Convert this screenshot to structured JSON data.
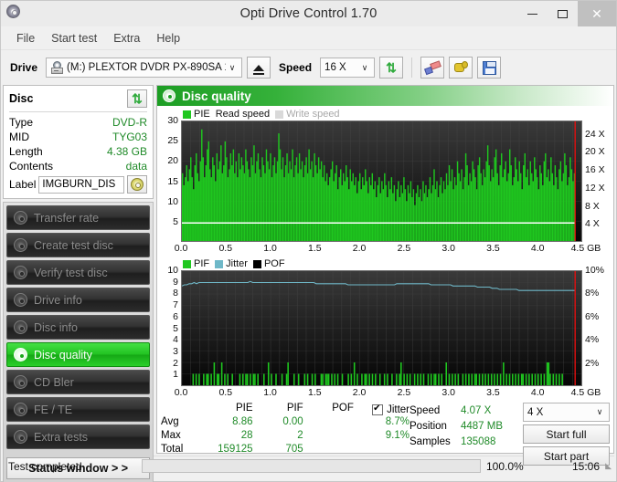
{
  "window": {
    "title": "Opti Drive Control 1.70",
    "app_icon": "disc-icon",
    "minimize": "–",
    "maximize": "□",
    "close": "✕"
  },
  "menu": [
    "File",
    "Start test",
    "Extra",
    "Help"
  ],
  "toolbar": {
    "drive_label": "Drive",
    "drive_value": "(M:)  PLEXTOR DVDR   PX-890SA 1.00",
    "eject_icon": "eject-icon",
    "speed_label": "Speed",
    "speed_value": "16 X",
    "refresh_icon": "refresh-icon",
    "erase_icon": "erase-icon",
    "hand_icon": "hand-icon",
    "save_icon": "save-icon"
  },
  "disc_panel": {
    "title": "Disc",
    "refresh_icon": "refresh-icon",
    "rows": [
      {
        "key": "Type",
        "value": "DVD-R"
      },
      {
        "key": "MID",
        "value": "TYG03"
      },
      {
        "key": "Length",
        "value": "4.38 GB"
      },
      {
        "key": "Contents",
        "value": "data"
      }
    ],
    "label_key": "Label",
    "label_value": "IMGBURN_DIS",
    "label_button_icon": "disc-icon"
  },
  "nav": {
    "items": [
      {
        "label": "Transfer rate",
        "active": false
      },
      {
        "label": "Create test disc",
        "active": false
      },
      {
        "label": "Verify test disc",
        "active": false
      },
      {
        "label": "Drive info",
        "active": false
      },
      {
        "label": "Disc info",
        "active": false
      },
      {
        "label": "Disc quality",
        "active": true
      },
      {
        "label": "CD Bler",
        "active": false
      },
      {
        "label": "FE / TE",
        "active": false
      },
      {
        "label": "Extra tests",
        "active": false
      }
    ],
    "status_window": "Status window > >"
  },
  "content": {
    "header_title": "Disc quality",
    "header_icon": "disc-icon"
  },
  "chart_data": [
    {
      "type": "bar",
      "title": "PIE / Read speed",
      "legend": [
        {
          "label": "PIE",
          "color": "#1fc71f",
          "active": true
        },
        {
          "label": "Read speed",
          "color": "#ffffff",
          "active": true
        },
        {
          "label": "Write speed",
          "color": "#d9d9d9",
          "active": false
        }
      ],
      "xlabel": "GB",
      "xticks": [
        "0.0",
        "0.5",
        "1.0",
        "1.5",
        "2.0",
        "2.5",
        "3.0",
        "3.5",
        "4.0",
        "4.5"
      ],
      "xlim": [
        0.0,
        4.5
      ],
      "ylabel_left": "PIE",
      "yticks_left": [
        5,
        10,
        15,
        20,
        25,
        30
      ],
      "ylim_left": [
        0,
        30
      ],
      "ylabel_right": "Speed",
      "yticks_right": [
        "4 X",
        "8 X",
        "12 X",
        "16 X",
        "20 X",
        "24 X"
      ],
      "ylim_right": [
        0,
        27
      ],
      "grid": true,
      "read_speed_line": 4.07,
      "end_marker_position": 4.43,
      "series": [
        {
          "name": "PIE",
          "color": "#1fc71f",
          "values": [
            17,
            14,
            16,
            19,
            15,
            18,
            21,
            16,
            13,
            19,
            22,
            17,
            15,
            20,
            28,
            21,
            16,
            19,
            23,
            25,
            18,
            16,
            21,
            19,
            15,
            22,
            18,
            20,
            24,
            17,
            19,
            25,
            21,
            16,
            18,
            22,
            19,
            23,
            17,
            20,
            16,
            22,
            18,
            21,
            19,
            17,
            23,
            20,
            18,
            16,
            21,
            19,
            24,
            17,
            20,
            22,
            18,
            16,
            21,
            19,
            17,
            23,
            20,
            18,
            22,
            16,
            19,
            21,
            17,
            20,
            27,
            23,
            18,
            21,
            16,
            19,
            22,
            17,
            20,
            18,
            23,
            16,
            19,
            21,
            17,
            22,
            18,
            20,
            16,
            19,
            21,
            17,
            23,
            18,
            20,
            16,
            22,
            19,
            17,
            21,
            18,
            20,
            16,
            19,
            15,
            17,
            14,
            16,
            18,
            20,
            15,
            17,
            19,
            13,
            16,
            18,
            14,
            17,
            15,
            19,
            16,
            13,
            18,
            15,
            17,
            14,
            16,
            12,
            15,
            17,
            13,
            16,
            14,
            18,
            15,
            12,
            16,
            14,
            17,
            13,
            15,
            11,
            14,
            16,
            12,
            15,
            13,
            17,
            14,
            11,
            15,
            13,
            16,
            12,
            14,
            10,
            13,
            15,
            11,
            14,
            12,
            16,
            13,
            10,
            14,
            12,
            15,
            11,
            13,
            9,
            12,
            14,
            11,
            13,
            10,
            15,
            12,
            14,
            11,
            13,
            16,
            12,
            14,
            18,
            13,
            15,
            11,
            14,
            16,
            12,
            15,
            13,
            17,
            14,
            19,
            15,
            18,
            13,
            16,
            14,
            20,
            17,
            15,
            18,
            13,
            16,
            22,
            19,
            14,
            17,
            15,
            20,
            18,
            16,
            13,
            19,
            21,
            17,
            14,
            18,
            16,
            20,
            24,
            19,
            15,
            18,
            16,
            21,
            23,
            17,
            14,
            19,
            22,
            16,
            18,
            20,
            15,
            17,
            23,
            19,
            14,
            16,
            21,
            18,
            15,
            20,
            17,
            13,
            19,
            22,
            16,
            18,
            14,
            20,
            17,
            15,
            21,
            18,
            16,
            13,
            19,
            17,
            14,
            20,
            22,
            16,
            18,
            15,
            21,
            17,
            14,
            19,
            16,
            13,
            18,
            20,
            15,
            17,
            22,
            19,
            14,
            16,
            21,
            18,
            15,
            17
          ]
        }
      ]
    },
    {
      "type": "bar",
      "title": "PIF / Jitter / POF",
      "legend": [
        {
          "label": "PIF",
          "color": "#1fc71f",
          "active": true
        },
        {
          "label": "Jitter",
          "color": "#6fb8c8",
          "active": true
        },
        {
          "label": "POF",
          "color": "#000000",
          "active": true
        }
      ],
      "xlabel": "GB",
      "xticks": [
        "0.0",
        "0.5",
        "1.0",
        "1.5",
        "2.0",
        "2.5",
        "3.0",
        "3.5",
        "4.0",
        "4.5"
      ],
      "xlim": [
        0.0,
        4.5
      ],
      "ylabel_left": "PIF",
      "yticks_left": [
        1,
        2,
        3,
        4,
        5,
        6,
        7,
        8,
        9,
        10
      ],
      "ylim_left": [
        0,
        10
      ],
      "ylabel_right": "Jitter",
      "yticks_right": [
        "2%",
        "4%",
        "6%",
        "8%",
        "10%"
      ],
      "ylim_right": [
        0,
        10
      ],
      "grid": true,
      "end_marker_position": 4.43,
      "series": [
        {
          "name": "PIF",
          "color": "#1fc71f",
          "values": [
            0,
            0,
            0,
            0,
            0,
            0,
            0,
            1,
            0,
            1,
            0,
            1,
            0,
            0,
            1,
            0,
            1,
            1,
            0,
            1,
            0,
            2,
            0,
            1,
            1,
            0,
            2,
            0,
            1,
            0,
            1,
            0,
            0,
            1,
            0,
            0,
            0,
            0,
            1,
            0,
            1,
            0,
            1,
            1,
            0,
            1,
            0,
            1,
            1,
            0,
            1,
            0,
            0,
            0,
            1,
            0,
            0,
            2,
            0,
            1,
            0,
            0,
            1,
            0,
            0,
            0,
            1,
            0,
            0,
            1,
            2,
            0,
            0,
            0,
            1,
            0,
            0,
            1,
            0,
            0,
            0,
            1,
            0,
            1,
            0,
            0,
            1,
            0,
            1,
            0,
            0,
            0,
            1,
            1,
            0,
            1,
            1,
            1,
            0,
            1,
            0,
            1,
            0,
            1,
            0,
            0,
            1,
            0,
            0,
            0,
            1,
            0,
            1,
            0,
            2,
            0,
            1,
            0,
            0,
            1,
            0,
            1,
            1,
            0,
            1,
            0,
            1,
            0,
            1,
            0,
            0,
            1,
            0,
            0,
            1,
            0,
            1,
            0,
            0,
            1,
            0,
            0,
            1,
            0,
            1,
            2,
            0,
            1,
            0,
            1,
            0,
            1,
            0,
            0,
            1,
            0,
            1,
            0,
            1,
            0,
            1,
            0,
            0,
            1,
            0,
            1,
            0,
            1,
            1,
            0,
            1,
            0,
            1,
            0,
            0,
            2,
            0,
            1,
            0,
            1,
            0,
            1,
            0,
            1,
            0,
            0,
            1,
            0,
            1,
            0,
            1,
            0,
            1,
            0,
            1,
            1,
            0,
            1,
            0,
            1,
            0,
            1,
            0,
            1,
            0,
            1,
            0,
            1,
            0,
            1,
            0,
            1,
            0,
            2,
            0,
            1,
            0,
            1,
            0,
            1,
            0,
            1,
            0,
            1,
            0,
            1,
            1,
            0,
            1,
            0,
            1,
            0,
            1,
            0,
            1,
            0,
            1,
            0,
            1,
            0,
            1,
            0,
            2,
            2,
            1,
            0,
            1,
            0,
            1,
            0,
            1,
            0,
            1,
            0,
            0,
            0,
            0,
            0,
            0,
            0,
            0
          ]
        },
        {
          "name": "Jitter",
          "color": "#6fb8c8",
          "values": [
            8.7,
            8.8,
            8.8,
            8.9,
            8.9,
            9.0,
            8.9,
            9.0,
            9.0,
            9.0,
            9.0,
            9.0,
            9.0,
            9.0,
            9.0,
            9.0,
            9.0,
            9.0,
            9.0,
            9.0,
            9.0,
            9.0,
            9.0,
            9.0,
            9.0,
            9.0,
            9.0,
            9.0,
            9.1,
            9.0,
            9.0,
            9.0,
            9.0,
            9.0,
            9.0,
            9.0,
            9.0,
            9.0,
            9.0,
            9.0,
            9.0,
            9.0,
            9.0,
            9.0,
            9.0,
            9.0,
            9.0,
            9.0,
            9.0,
            9.0,
            9.0,
            9.0,
            9.0,
            9.0,
            9.0,
            8.9,
            8.9,
            8.9,
            8.9,
            8.9,
            8.9,
            8.9,
            8.9,
            8.9,
            8.9,
            8.9,
            8.9,
            8.9,
            8.8,
            8.8,
            8.8,
            8.8,
            8.8,
            8.8,
            8.8,
            8.8,
            8.8,
            8.8,
            8.8,
            8.8,
            8.8,
            8.8,
            8.8,
            8.8,
            8.8,
            8.8,
            8.8,
            8.8,
            8.9,
            8.9,
            8.9,
            8.9,
            8.9,
            8.9,
            8.9,
            8.9,
            8.9,
            8.9,
            8.9,
            8.9,
            8.9,
            8.9,
            8.8,
            8.8,
            8.8,
            8.8,
            8.8,
            8.8,
            8.8,
            8.8,
            8.8,
            8.7,
            8.7,
            8.7,
            8.7,
            8.7,
            8.7,
            8.7,
            8.7,
            8.7,
            8.7,
            8.6,
            8.6,
            8.6,
            8.6,
            8.6,
            8.6,
            8.5,
            8.5,
            8.5,
            8.4,
            8.4,
            8.4,
            8.4,
            8.4,
            8.4,
            8.4,
            8.4,
            8.3,
            8.3,
            8.3,
            8.3,
            8.3,
            8.3,
            8.3,
            8.3,
            8.3,
            8.3,
            8.3,
            8.3,
            8.3,
            8.3,
            8.3,
            8.3,
            8.3,
            8.3,
            8.3,
            8.3,
            8.3,
            8.3,
            8.3,
            8.3
          ]
        }
      ]
    }
  ],
  "stats": {
    "columns": [
      "PIE",
      "PIF",
      "POF",
      "Jitter"
    ],
    "jitter_checkbox_checked": true,
    "rows": [
      {
        "label": "Avg",
        "pie": "8.86",
        "pif": "0.00",
        "pof": "",
        "jitter": "8.7%"
      },
      {
        "label": "Max",
        "pie": "28",
        "pif": "2",
        "pof": "",
        "jitter": "9.1%"
      },
      {
        "label": "Total",
        "pie": "159125",
        "pif": "705",
        "pof": "",
        "jitter": ""
      }
    ],
    "info": [
      {
        "key": "Speed",
        "value": "4.07 X"
      },
      {
        "key": "Position",
        "value": "4487 MB"
      },
      {
        "key": "Samples",
        "value": "135088"
      }
    ],
    "speed_select": "4 X",
    "start_full": "Start full",
    "start_part": "Start part"
  },
  "statusbar": {
    "text": "Test completed",
    "progress_pct": "100.0%",
    "progress_value": 100,
    "elapsed": "15:06"
  }
}
